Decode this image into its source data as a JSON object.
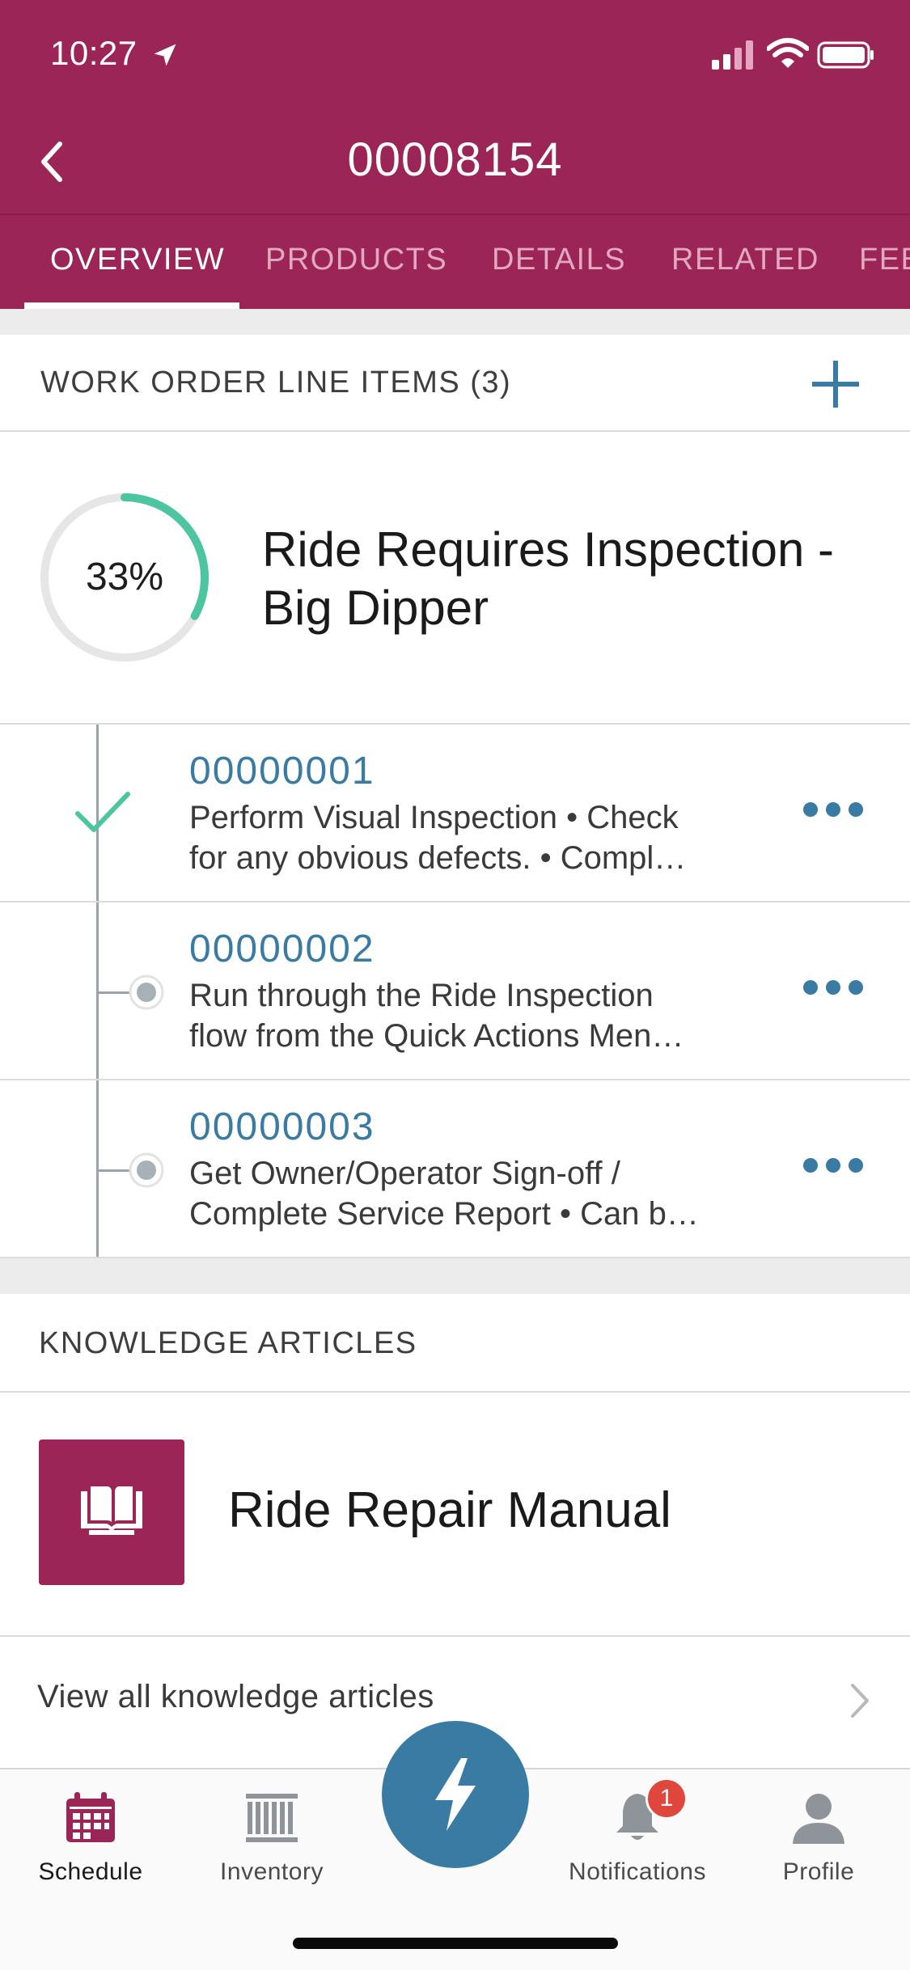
{
  "status_bar": {
    "time": "10:27"
  },
  "nav": {
    "title": "00008154"
  },
  "tabs": [
    {
      "label": "OVERVIEW",
      "active": true
    },
    {
      "label": "PRODUCTS",
      "active": false
    },
    {
      "label": "DETAILS",
      "active": false
    },
    {
      "label": "RELATED",
      "active": false
    },
    {
      "label": "FEE",
      "active": false
    }
  ],
  "work_order": {
    "section_title": "WORK ORDER LINE ITEMS (3)",
    "progress_percent": 33,
    "progress_label": "33%",
    "name_line1": "Ride Requires Inspection -",
    "name_line2": "Big Dipper"
  },
  "line_items": [
    {
      "number": "00000001",
      "desc_line1": "Perform Visual Inspection • Check",
      "desc_line2": "for any obvious defects. • Compl…",
      "status": "completed"
    },
    {
      "number": "00000002",
      "desc_line1": "Run through the Ride Inspection",
      "desc_line2": "flow from the Quick Actions Men…",
      "status": "pending"
    },
    {
      "number": "00000003",
      "desc_line1": "Get Owner/Operator Sign-off /",
      "desc_line2": "Complete Service Report • Can b…",
      "status": "pending"
    }
  ],
  "knowledge": {
    "section_title": "KNOWLEDGE ARTICLES",
    "article_title": "Ride Repair Manual",
    "view_all_label": "View all knowledge articles"
  },
  "tab_bar": {
    "items": [
      {
        "label": "Schedule",
        "icon": "calendar-icon",
        "active": true
      },
      {
        "label": "Inventory",
        "icon": "barcode-icon",
        "active": false
      },
      {
        "label": "Notifications",
        "icon": "bell-icon",
        "active": false,
        "badge": "1"
      },
      {
        "label": "Profile",
        "icon": "person-icon",
        "active": false
      }
    ],
    "fab_icon": "lightning-icon"
  },
  "colors": {
    "brand": "#9c2557",
    "accent_blue": "#3a7ba3",
    "progress_green": "#4cc5a0",
    "badge_red": "#e0473c"
  }
}
